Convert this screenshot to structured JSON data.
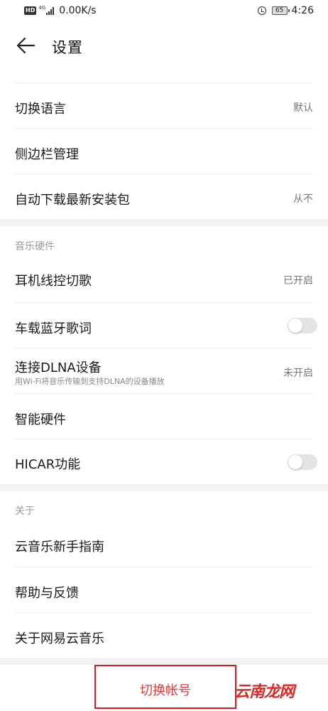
{
  "status_bar": {
    "hd": "HD",
    "net": "4G",
    "speed": "0.00K/s",
    "battery": "65",
    "time": "4:26"
  },
  "header": {
    "title": "设置"
  },
  "general": {
    "items": [
      {
        "label": "切换语言",
        "value": "默认"
      },
      {
        "label": "侧边栏管理"
      },
      {
        "label": "自动下载最新安装包",
        "value": "从不"
      }
    ]
  },
  "hardware": {
    "title": "音乐硬件",
    "items": [
      {
        "label": "耳机线控切歌",
        "value": "已开启"
      },
      {
        "label": "车载蓝牙歌词",
        "toggle": false
      },
      {
        "label": "连接DLNA设备",
        "sub": "用Wi-Fi将音乐传输到支持DLNA的设备播放",
        "value": "未开启"
      },
      {
        "label": "智能硬件"
      },
      {
        "label": "HICAR功能",
        "toggle": false
      }
    ]
  },
  "about": {
    "title": "关于",
    "items": [
      {
        "label": "云音乐新手指南"
      },
      {
        "label": "帮助与反馈"
      },
      {
        "label": "关于网易云音乐"
      }
    ]
  },
  "footer": {
    "switch_account": "切换帐号"
  },
  "watermark": "云南龙网",
  "colors": {
    "accent_red": "#e23c3c",
    "highlight_border": "#d61d1d"
  }
}
